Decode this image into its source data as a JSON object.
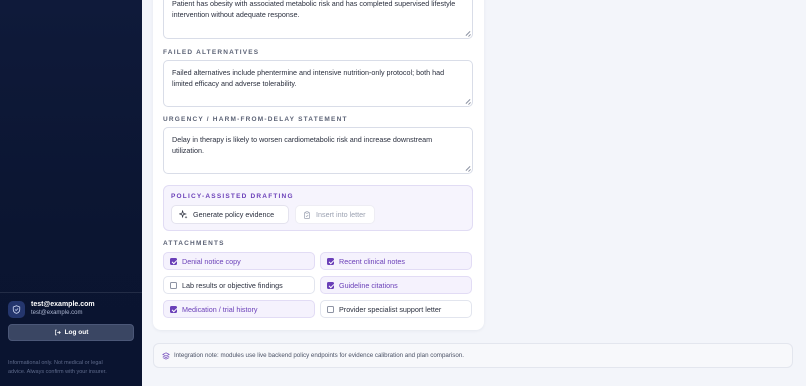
{
  "sidebar": {
    "user_name": "test@example.com",
    "user_email": "test@example.com",
    "logout_label": "Log out",
    "note": "Informational only. Not medical or legal advice. Always confirm with your insurer."
  },
  "form": {
    "top_text_partial": "Patient has obesity with associated metabolic risk and has completed supervised lifestyle intervention without adequate response.",
    "failed_alternatives": {
      "label": "FAILED ALTERNATIVES",
      "value": "Failed alternatives include phentermine and intensive nutrition-only protocol; both had limited efficacy and adverse tolerability."
    },
    "urgency": {
      "label": "URGENCY / HARM-FROM-DELAY STATEMENT",
      "value": "Delay in therapy is likely to worsen cardiometabolic risk and increase downstream utilization."
    },
    "policy": {
      "label": "POLICY-ASSISTED DRAFTING",
      "generate_label": "Generate policy evidence",
      "insert_label": "Insert into letter"
    },
    "attachments": {
      "label": "ATTACHMENTS",
      "items": [
        {
          "label": "Denial notice copy",
          "checked": true
        },
        {
          "label": "Recent clinical notes",
          "checked": true
        },
        {
          "label": "Lab results or objective findings",
          "checked": false
        },
        {
          "label": "Guideline citations",
          "checked": true
        },
        {
          "label": "Medication / trial history",
          "checked": true
        },
        {
          "label": "Provider specialist support letter",
          "checked": false
        }
      ]
    }
  },
  "integration_note": "Integration note: modules use live backend policy endpoints for evidence calibration and plan comparison.",
  "colors": {
    "accent": "#6a3fb8",
    "sidebar_bg": "#0f1a3a",
    "page_bg": "#f3f5fa"
  }
}
